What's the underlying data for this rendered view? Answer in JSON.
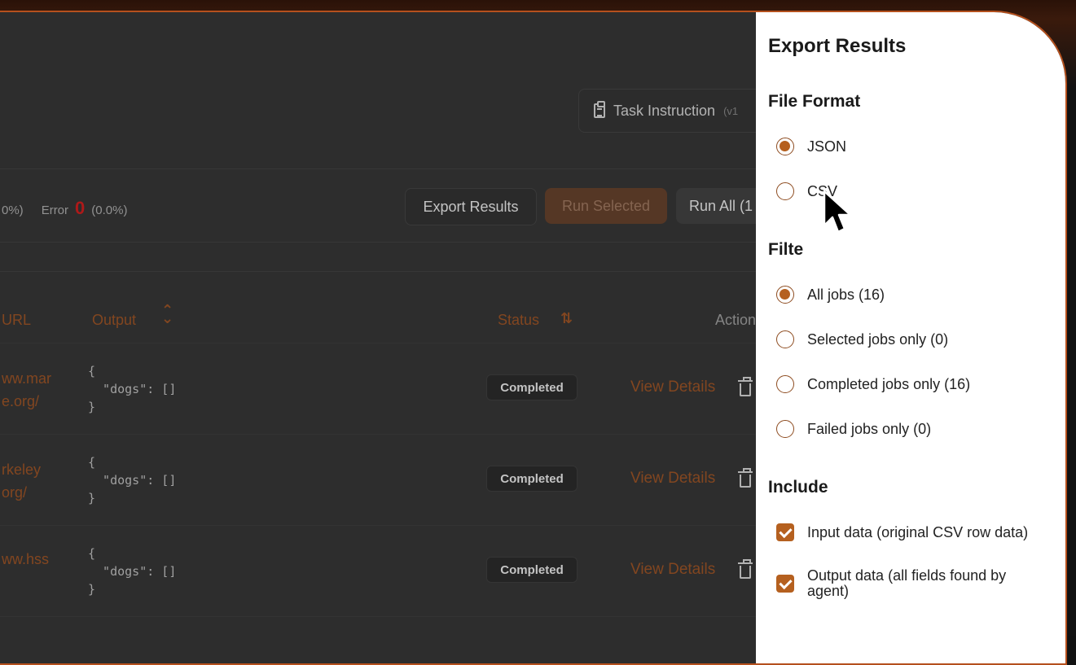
{
  "header": {
    "task_instruction_label": "Task Instruction",
    "task_instruction_version": "(v1"
  },
  "stats": {
    "left_fragment": "0%)",
    "error_label": "Error",
    "error_count": "0",
    "error_pct": "(0.0%)"
  },
  "toolbar": {
    "export_label": "Export Results",
    "run_selected_label": "Run Selected",
    "run_all_label": "Run All (1"
  },
  "table": {
    "columns": {
      "url": "URL",
      "output": "Output",
      "status": "Status",
      "actions": "Action"
    },
    "rows": [
      {
        "url_line1": "ww.mar",
        "url_line2": "e.org/",
        "output": "{\n  \"dogs\": []\n}",
        "status": "Completed",
        "view": "View Details"
      },
      {
        "url_line1": "rkeley",
        "url_line2": "org/",
        "output": "{\n  \"dogs\": []\n}",
        "status": "Completed",
        "view": "View Details"
      },
      {
        "url_line1": "ww.hss",
        "url_line2": "",
        "output": "{\n  \"dogs\": []\n}",
        "status": "Completed",
        "view": "View Details"
      }
    ]
  },
  "export_panel": {
    "title": "Export Results",
    "file_format": {
      "title": "File Format",
      "options": [
        "JSON",
        "CSV"
      ],
      "selected": "JSON"
    },
    "filter": {
      "title": "Filte",
      "options": [
        "All jobs (16)",
        "Selected jobs only (0)",
        "Completed jobs only (16)",
        "Failed jobs only (0)"
      ],
      "selected": "All jobs (16)"
    },
    "include": {
      "title": "Include",
      "options": [
        "Input data (original CSV row data)",
        "Output data (all fields found by agent)"
      ]
    }
  },
  "colors": {
    "accent": "#b5601f",
    "error": "#b81b1b",
    "link": "#8a4a22"
  }
}
